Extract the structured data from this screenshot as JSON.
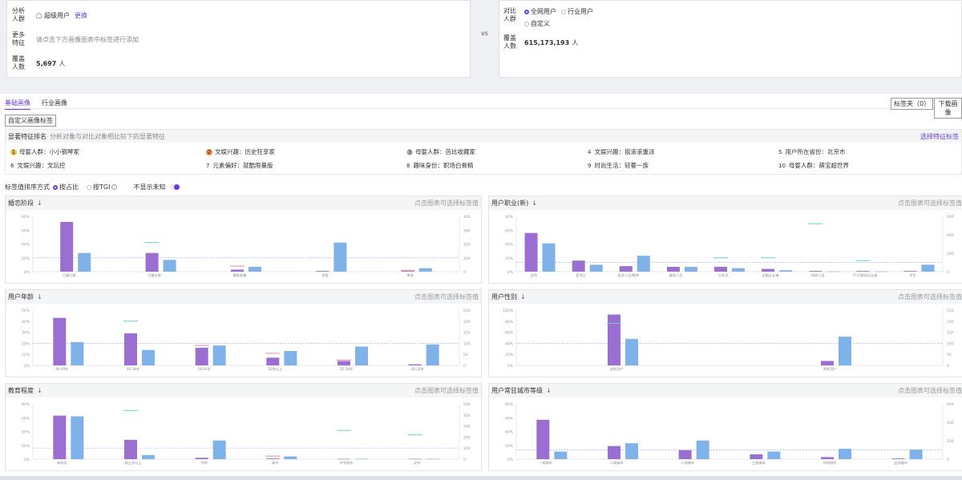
{
  "compare": {
    "left": {
      "group_label": "分析人群",
      "group_value": "超级用户",
      "change_link": "更换",
      "more_label": "更多特征",
      "more_placeholder": "请点击下方画像图表中标签进行添加",
      "coverage_label": "覆盖人数",
      "coverage_value": "5,697",
      "coverage_unit": "人"
    },
    "vs": "vs",
    "right": {
      "group_label": "对比人群",
      "options": [
        "全网用户",
        "行业用户",
        "自定义"
      ],
      "selected": "全网用户",
      "coverage_label": "覆盖人数",
      "coverage_value": "615,173,193",
      "coverage_unit": "人"
    }
  },
  "tabs": [
    "基础画像",
    "行业画像"
  ],
  "active_tab": "基础画像",
  "buttons": {
    "tag_folder": "标签夹（0）",
    "download": "下载画像",
    "custom_tag": "自定义画像标签"
  },
  "features": {
    "title": "显著特征排名",
    "desc": "分析对象与对比对象相比较下的显著特征",
    "select_link": "选择特征标签",
    "items": [
      {
        "rank": "1",
        "text": "母婴人群：小小钢琴家"
      },
      {
        "rank": "2",
        "text": "文娱兴趣：历史狂享家"
      },
      {
        "rank": "3",
        "text": "母婴人群：芭比收藏家"
      },
      {
        "rank": "4",
        "text": "文娱兴趣：摇滚滚重派"
      },
      {
        "rank": "5",
        "text": "用户所在省份：北京市"
      },
      {
        "rank": "6",
        "text": "文娱兴趣：文玩控"
      },
      {
        "rank": "7",
        "text": "元素偏好：就酷限量版"
      },
      {
        "rank": "8",
        "text": "趣味身份：职场白骨精"
      },
      {
        "rank": "9",
        "text": "时尚生活：轻奢一族"
      },
      {
        "rank": "10",
        "text": "母婴人群：萌宝超世界"
      }
    ]
  },
  "sort": {
    "label": "标签值排序方式",
    "options": [
      "按占比",
      "按TGI"
    ],
    "selected": "按占比",
    "unknown_label": "不显示未知"
  },
  "colors": {
    "accent": "#6a3fd1",
    "purple_bar": "#9b6fd1",
    "blue_bar": "#7fb2e8",
    "tgi_mark": "#66d0c8",
    "tgi_mark_low": "#e58a9a",
    "tgi_line": "#9fb8ea"
  },
  "panel_hint": "点击图表可选择标签值",
  "chart_data": [
    {
      "id": "marriage",
      "title": "婚恋阶段",
      "type": "bar",
      "categories": [
        "已婚已育",
        "已婚未育",
        "婚前准备",
        "恋爱",
        "单身"
      ],
      "series": [
        {
          "values": [
            72,
            27,
            3,
            1,
            1
          ]
        },
        {
          "values": [
            27,
            17,
            7,
            42,
            5
          ]
        }
      ],
      "tgi": [
        null,
        210,
        40,
        null,
        10
      ],
      "ylim_left": [
        0,
        80
      ],
      "yticks_left": [
        "0%",
        "20%",
        "40%",
        "60%",
        "80%"
      ],
      "ylim_right": [
        0,
        400
      ],
      "yticks_right": [
        "0",
        "100",
        "200",
        "300",
        "400"
      ],
      "baseline": 100
    },
    {
      "id": "occupation",
      "title": "用户职业(新)",
      "type": "bar",
      "categories": [
        "白领",
        "蓝领工",
        "医务人员/教师",
        "媒体人员",
        "公务员",
        "金融从业者",
        "科研人员",
        "IT/互联网从业者",
        "学生"
      ],
      "series": [
        {
          "values": [
            56,
            16,
            8,
            7,
            7,
            4,
            1,
            1,
            1
          ]
        },
        {
          "values": [
            41,
            10,
            23,
            7,
            5,
            2,
            0.3,
            0.3,
            10
          ]
        }
      ],
      "tgi": [
        null,
        null,
        null,
        null,
        150,
        150,
        520,
        120,
        null
      ],
      "ylim_left": [
        0,
        80
      ],
      "yticks_left": [
        "0%",
        "20%",
        "40%",
        "60%",
        "80%"
      ],
      "ylim_right": [
        0,
        600
      ],
      "yticks_right": [
        "0",
        "200",
        "400",
        "600"
      ],
      "baseline": 100
    },
    {
      "id": "age",
      "title": "用户年龄",
      "type": "bar",
      "categories": [
        "40-49岁",
        "30-39岁",
        "18-24岁",
        "50岁以上",
        "25-29岁",
        "18-24岁"
      ],
      "series": [
        {
          "values": [
            43,
            29,
            16,
            7,
            4,
            1
          ]
        },
        {
          "values": [
            21,
            14,
            18,
            13,
            17,
            19
          ]
        }
      ],
      "tgi": [
        null,
        200,
        90,
        55,
        24,
        null
      ],
      "ylim_left": [
        0,
        50
      ],
      "yticks_left": [
        "0%",
        "10%",
        "20%",
        "30%",
        "40%",
        "50%"
      ],
      "ylim_right": [
        0,
        250
      ],
      "yticks_right": [
        "0",
        "50",
        "100",
        "150",
        "200",
        "250"
      ],
      "baseline": 100
    },
    {
      "id": "gender",
      "title": "用户性别",
      "type": "bar",
      "categories": [
        "女性用户",
        "男性用户"
      ],
      "series": [
        {
          "values": [
            92,
            8
          ]
        },
        {
          "values": [
            48,
            52
          ]
        }
      ],
      "tgi": [
        190,
        null
      ],
      "ylim_left": [
        0,
        100
      ],
      "yticks_left": [
        "0%",
        "20%",
        "40%",
        "60%",
        "80%",
        "100%"
      ],
      "ylim_right": [
        0,
        250
      ],
      "yticks_right": [
        "0",
        "50",
        "100",
        "150",
        "200",
        "250"
      ],
      "baseline": 100
    },
    {
      "id": "education",
      "title": "教育程度",
      "type": "bar",
      "categories": [
        "本科及",
        "硕士及以上",
        "专科",
        "高中",
        "中专职技",
        "初中"
      ],
      "series": [
        {
          "values": [
            63,
            28,
            2,
            1,
            0.5,
            0.5
          ]
        },
        {
          "values": [
            62,
            6,
            27,
            4,
            0.5,
            0.5
          ]
        }
      ],
      "tgi": [
        null,
        440,
        null,
        28,
        260,
        220
      ],
      "ylim_left": [
        0,
        80
      ],
      "yticks_left": [
        "0%",
        "20%",
        "40%",
        "60%",
        "80%"
      ],
      "ylim_right": [
        0,
        500
      ],
      "yticks_right": [
        "0",
        "100",
        "200",
        "300",
        "400",
        "500"
      ],
      "baseline": 100
    },
    {
      "id": "city",
      "title": "用户常驻城市等级",
      "type": "bar",
      "categories": [
        "一线城市",
        "二线城市",
        "二线城市",
        "三线城市",
        "四线城市",
        "五线城市"
      ],
      "series": [
        {
          "values": [
            57,
            19,
            13,
            7,
            3,
            1
          ]
        },
        {
          "values": [
            11,
            23,
            27,
            11,
            15,
            14
          ]
        }
      ],
      "tgi": [
        null,
        null,
        null,
        null,
        null,
        null
      ],
      "ylim_left": [
        0,
        80
      ],
      "yticks_left": [
        "0%",
        "20%",
        "40%",
        "60%",
        "80%"
      ],
      "ylim_right": [
        0,
        600
      ],
      "yticks_right": [
        "0",
        "200",
        "400",
        "600"
      ],
      "baseline": 100
    }
  ]
}
